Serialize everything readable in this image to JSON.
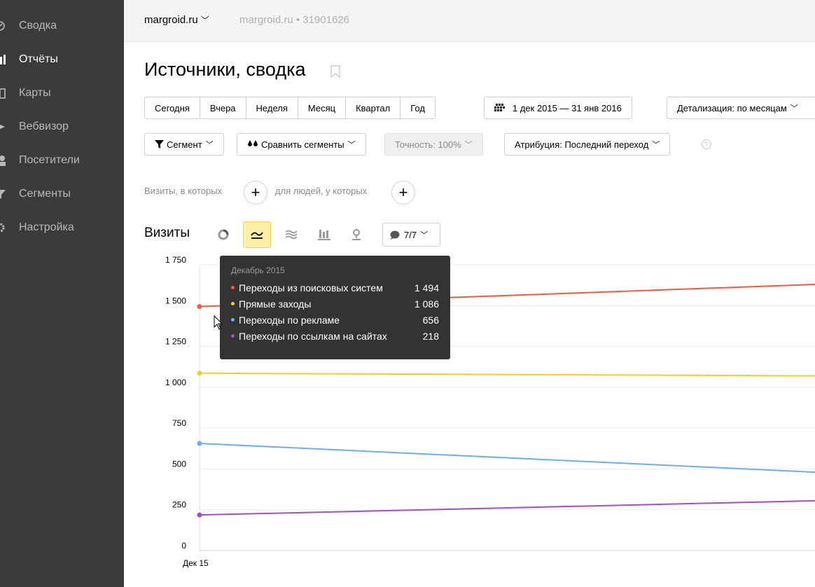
{
  "sidebar": {
    "items": [
      {
        "label": "Сводка",
        "icon": "dashboard-icon",
        "active": false
      },
      {
        "label": "Отчёты",
        "icon": "bar-chart-icon",
        "active": true
      },
      {
        "label": "Карты",
        "icon": "map-icon",
        "active": false
      },
      {
        "label": "Вебвизор",
        "icon": "play-icon",
        "active": false
      },
      {
        "label": "Посетители",
        "icon": "user-icon",
        "active": false
      },
      {
        "label": "Сегменты",
        "icon": "filter-icon",
        "active": false
      },
      {
        "label": "Настройка",
        "icon": "gear-icon",
        "active": false
      }
    ]
  },
  "header": {
    "site_name": "margroid.ru",
    "site_counter": "margroid.ru • 31901626"
  },
  "page": {
    "title": "Источники, сводка"
  },
  "periods": [
    "Сегодня",
    "Вчера",
    "Неделя",
    "Месяц",
    "Квартал",
    "Год"
  ],
  "date_range": "1 дек 2015 — 31 янв 2016",
  "detail": "Детализация: по месяцам",
  "filters": {
    "segment": "Сегмент",
    "compare": "Сравнить сегменты",
    "accuracy": "Точность: 100%",
    "attribution": "Атрибуция: Последний переход",
    "help": "?"
  },
  "condition": {
    "visits_text": "Визиты, в которых",
    "people_text": "для людей, у которых",
    "plus": "+"
  },
  "chart_header": {
    "title": "Визиты",
    "series_count": "7/7"
  },
  "tooltip": {
    "title": "Декабрь 2015",
    "rows": [
      {
        "name": "Переходы из поисковых систем",
        "value": "1 494",
        "color": "#f4593b"
      },
      {
        "name": "Прямые заходы",
        "value": "1 086",
        "color": "#fdc72f"
      },
      {
        "name": "Переходы по рекламе",
        "value": "656",
        "color": "#69aef0"
      },
      {
        "name": "Переходы по ссылкам на сайтах",
        "value": "218",
        "color": "#a94cc4"
      }
    ]
  },
  "chart_data": {
    "type": "line",
    "x": [
      "Дек 15",
      ""
    ],
    "x_tick_labels": [
      "Дек 15"
    ],
    "y_ticks": [
      0,
      250,
      500,
      750,
      1000,
      1250,
      1500,
      1750
    ],
    "y_tick_labels": [
      "0",
      "250",
      "500",
      "750",
      "1 000",
      "1 250",
      "1 500",
      "1 750"
    ],
    "ylim": [
      0,
      1750
    ],
    "grid": true,
    "series": [
      {
        "name": "Переходы из поисковых систем",
        "color": "#f4593b",
        "values": [
          1494,
          1630
        ]
      },
      {
        "name": "Прямые заходы",
        "color": "#fdc72f",
        "values": [
          1086,
          1070
        ]
      },
      {
        "name": "Переходы по рекламе",
        "color": "#69aef0",
        "values": [
          656,
          480
        ]
      },
      {
        "name": "Переходы по ссылкам на сайтах",
        "color": "#a94cc4",
        "values": [
          218,
          305
        ]
      }
    ]
  }
}
